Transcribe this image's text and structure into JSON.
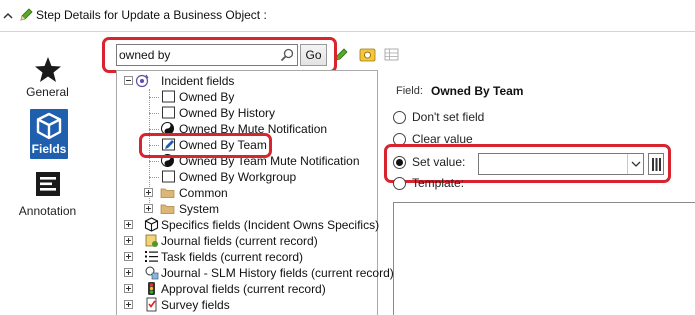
{
  "window": {
    "title": "Step Details for Update a Business Object :"
  },
  "nav": {
    "items": [
      {
        "label": "General",
        "icon": "star-icon"
      },
      {
        "label": "Fields",
        "icon": "cube-icon",
        "selected": true
      },
      {
        "label": "Annotation",
        "icon": "annotation-icon"
      }
    ]
  },
  "search": {
    "value": "owned by",
    "go_label": "Go"
  },
  "tree": {
    "root": "Incident fields",
    "children": [
      "Owned By",
      "Owned By History",
      "Owned By Mute Notification",
      "Owned By Team",
      "Owned By Team Mute Notification",
      "Owned By Workgroup"
    ],
    "folders": [
      "Common",
      "System"
    ],
    "groups": [
      "Specifics fields (Incident Owns Specifics)",
      "Journal fields (current record)",
      "Task fields (current record)",
      "Journal - SLM History fields (current record)",
      "Approval fields (current record)",
      "Survey fields"
    ]
  },
  "detail": {
    "field_label": "Field:",
    "field_value": "Owned By Team",
    "options": [
      "Don't set field",
      "Clear value",
      "Set value:",
      "Template:"
    ],
    "selected_option": "Set value:",
    "set_value": ""
  },
  "colors": {
    "highlight": "#d8242f",
    "nav_selected": "#1f5fae"
  }
}
